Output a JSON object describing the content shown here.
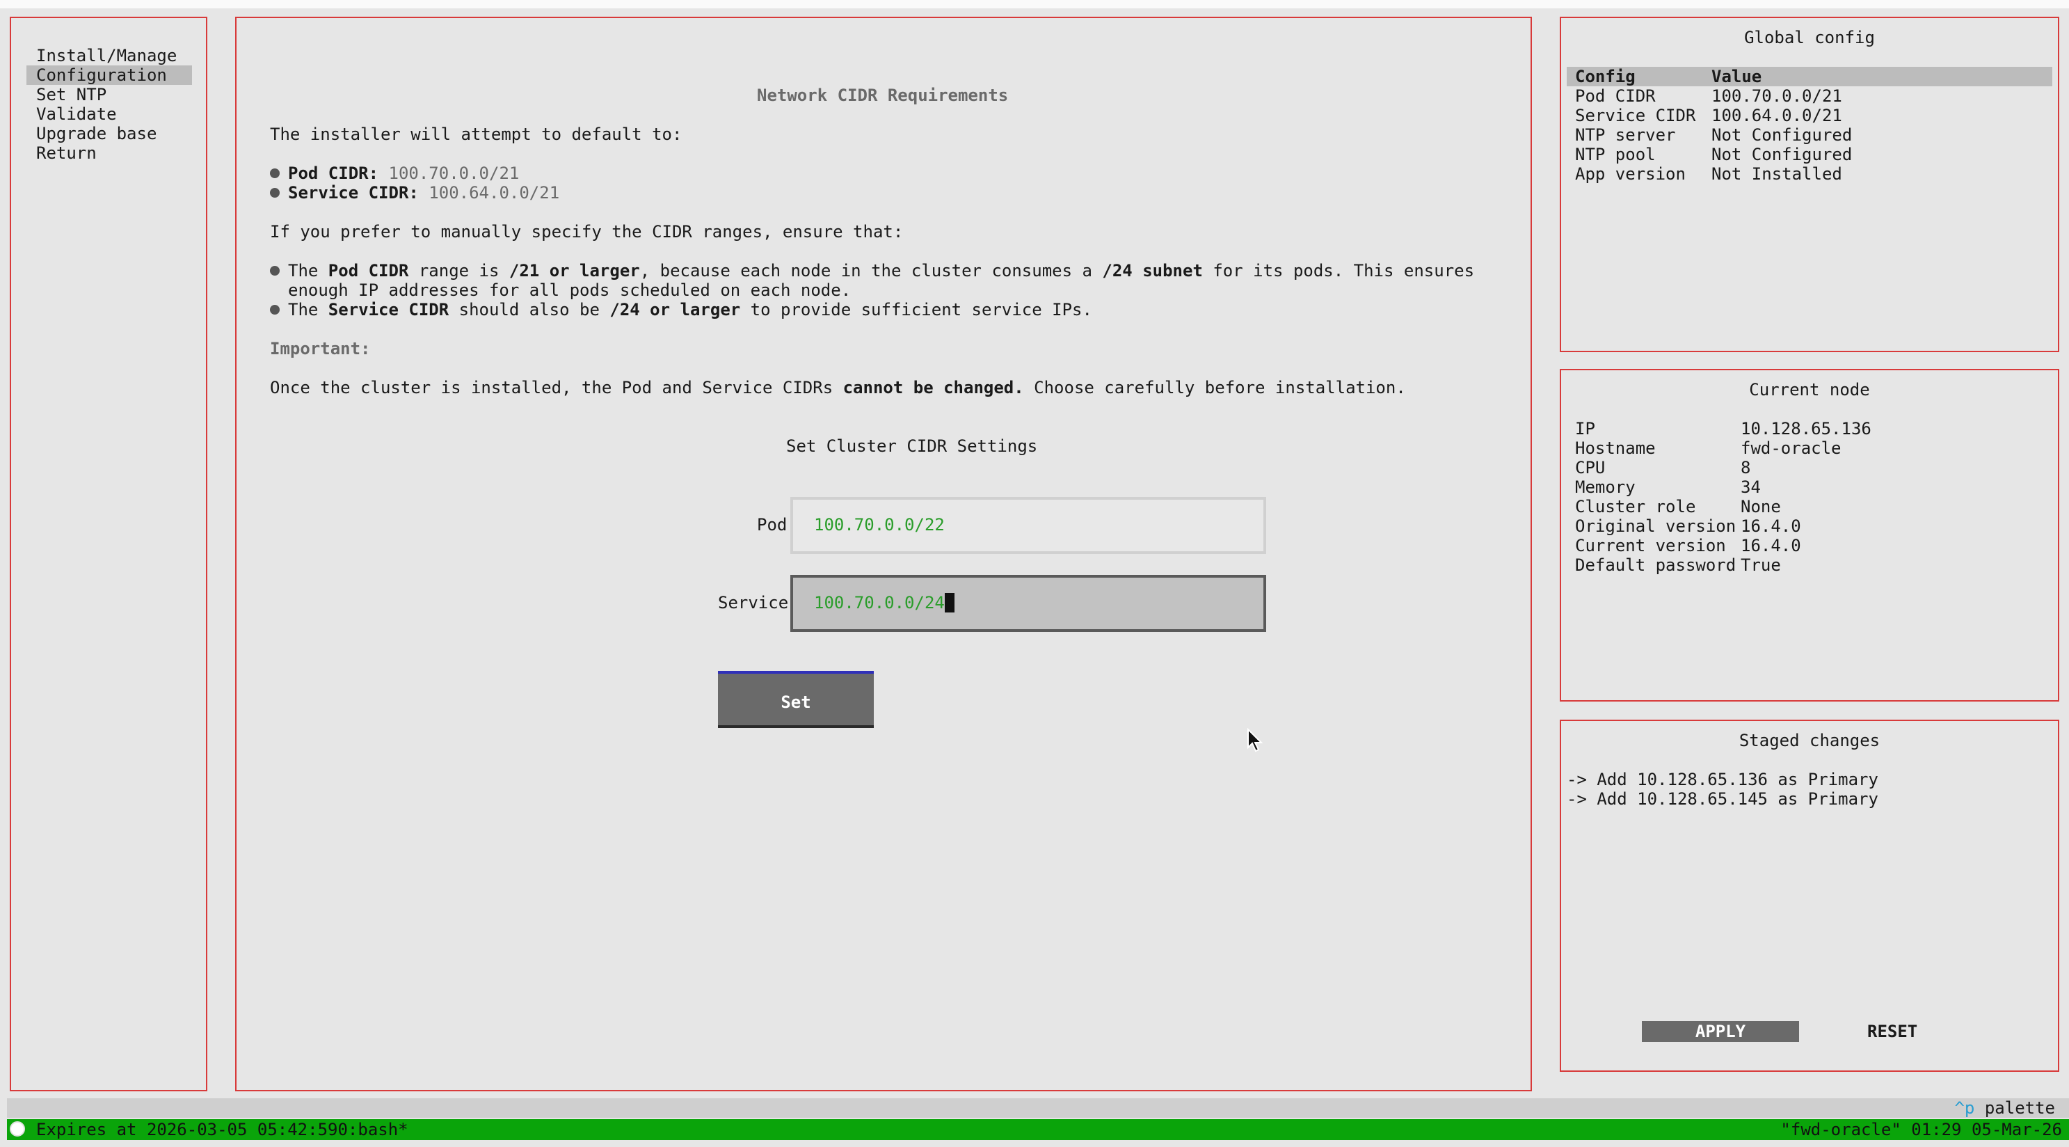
{
  "menu": {
    "items": [
      "Install/Manage",
      "Configuration",
      "Set NTP",
      "Validate",
      "Upgrade base",
      "Return"
    ],
    "selected": "Configuration"
  },
  "main": {
    "heading": "Network CIDR Requirements",
    "intro": "The installer will attempt to default to:",
    "defaults": {
      "pod_label": "Pod CIDR:",
      "pod_value": "100.70.0.0/21",
      "service_label": "Service CIDR:",
      "service_value": "100.64.0.0/21"
    },
    "manual_intro": "If you prefer to manually specify the CIDR ranges, ensure that:",
    "req1": {
      "t1": "The ",
      "b1": "Pod CIDR",
      "t2": " range is ",
      "b2": "/21 or larger",
      "t3": ", because each node in the cluster consumes a ",
      "b3": "/24 subnet",
      "t4": " for its pods. This ensures",
      "line2": "enough IP addresses for all pods scheduled on each node."
    },
    "req2": {
      "t1": "The ",
      "b1": "Service CIDR",
      "t2": " should also be ",
      "b2": "/24 or larger",
      "t3": " to provide sufficient service IPs."
    },
    "important_label": "Important:",
    "important_text": {
      "t1": "Once the cluster is installed, the Pod and Service CIDRs ",
      "b1": "cannot be changed.",
      "t2": " Choose carefully before installation."
    },
    "form_title": "Set Cluster CIDR Settings",
    "pod_label": "Pod",
    "pod_value": "100.70.0.0/22",
    "service_label": "Service",
    "service_value": "100.70.0.0/24",
    "set_button": "Set"
  },
  "global_config": {
    "title": "Global config",
    "headers": [
      "Config",
      "Value"
    ],
    "rows": [
      [
        "Pod CIDR",
        "100.70.0.0/21"
      ],
      [
        "Service CIDR",
        "100.64.0.0/21"
      ],
      [
        "NTP server",
        "Not Configured"
      ],
      [
        "NTP pool",
        "Not Configured"
      ],
      [
        "App version",
        "Not Installed"
      ]
    ]
  },
  "current_node": {
    "title": "Current node",
    "rows": [
      [
        "IP",
        "10.128.65.136"
      ],
      [
        "Hostname",
        "fwd-oracle"
      ],
      [
        "CPU",
        "8"
      ],
      [
        "Memory",
        "34"
      ],
      [
        "Cluster role",
        "None"
      ],
      [
        "Original version",
        "16.4.0"
      ],
      [
        "Current version",
        "16.4.0"
      ],
      [
        "Default password",
        "True"
      ]
    ]
  },
  "staged_changes": {
    "title": "Staged changes",
    "items": [
      "-> Add 10.128.65.136 as Primary",
      "-> Add 10.128.65.145 as Primary"
    ],
    "apply_button": "APPLY",
    "reset_button": "RESET"
  },
  "palette": {
    "key": "^p",
    "label": "palette"
  },
  "status_bar": {
    "left": "Expires at 2026-03-05 05:42:590:bash*",
    "right": "\"fwd-oracle\" 01:29 05-Mar-26"
  },
  "colors": {
    "border": "#d83a3a",
    "input_text": "#2a9d2a",
    "status_bg": "#0aa40a",
    "selection": "#bcbcbc",
    "button": "#6a6a6a"
  }
}
